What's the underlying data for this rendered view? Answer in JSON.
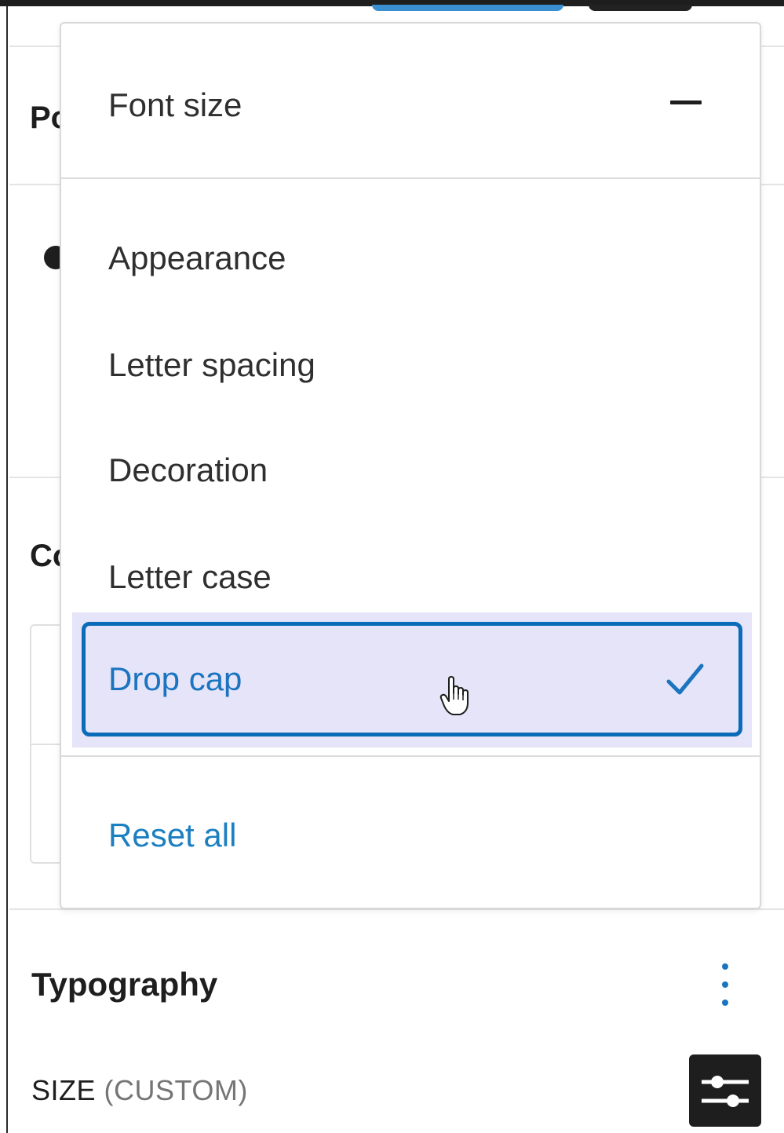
{
  "background": {
    "panel_title_partial": "Po",
    "color_title_partial": "Co"
  },
  "popover": {
    "header_item": "Font size",
    "items": [
      {
        "label": "Appearance"
      },
      {
        "label": "Letter spacing"
      },
      {
        "label": "Decoration"
      },
      {
        "label": "Letter case"
      }
    ],
    "selected_item": {
      "label": "Drop cap",
      "checked": true
    },
    "reset_label": "Reset all"
  },
  "typography": {
    "title": "Typography",
    "size_label": "SIZE",
    "size_mode": "(CUSTOM)"
  },
  "colors": {
    "accent": "#1b74c0",
    "highlight": "#e5e4f8",
    "focus_border": "#0a6bb8"
  },
  "icons": {
    "header_action": "minus-icon",
    "selected_indicator": "check-icon",
    "cursor": "hand-pointer-icon",
    "options": "kebab-menu-icon",
    "custom_size": "sliders-icon"
  }
}
